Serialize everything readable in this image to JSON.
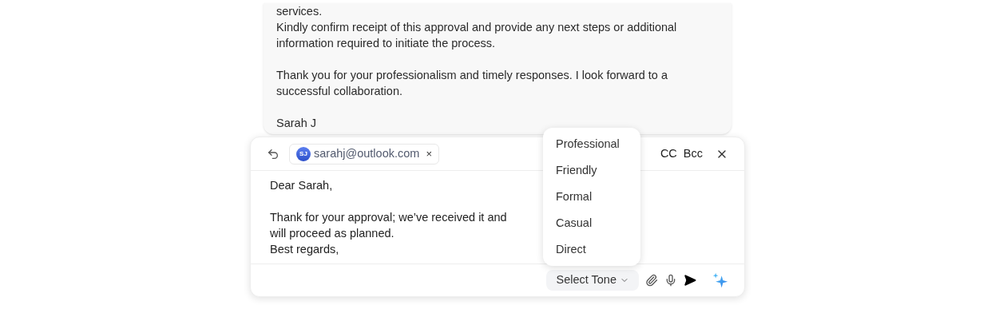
{
  "previous_message": {
    "paragraphs": [
      [
        "services.",
        "Kindly confirm receipt of this approval and provide any next steps or additional",
        "information required to initiate the process."
      ],
      [
        "Thank you for your professionalism and timely responses. I look forward to a",
        "successful collaboration."
      ],
      [
        "Sarah J"
      ]
    ]
  },
  "compose": {
    "recipient": {
      "initials": "SJ",
      "email": "sarahj@outlook.com",
      "remove": "×"
    },
    "cc": "CC",
    "bcc": "Bcc",
    "body": [
      [
        "Dear Sarah,"
      ],
      [
        "Thank for your approval; we’ve received it and",
        "will proceed as planned.",
        "Best regards,"
      ]
    ],
    "tone_button": "Select Tone",
    "tone_menu": [
      {
        "label": "Professional",
        "selected": false
      },
      {
        "label": "Friendly",
        "selected": false
      },
      {
        "label": "Formal",
        "selected": false
      },
      {
        "label": "Casual",
        "selected": false
      },
      {
        "label": "Direct",
        "selected": false
      }
    ]
  }
}
